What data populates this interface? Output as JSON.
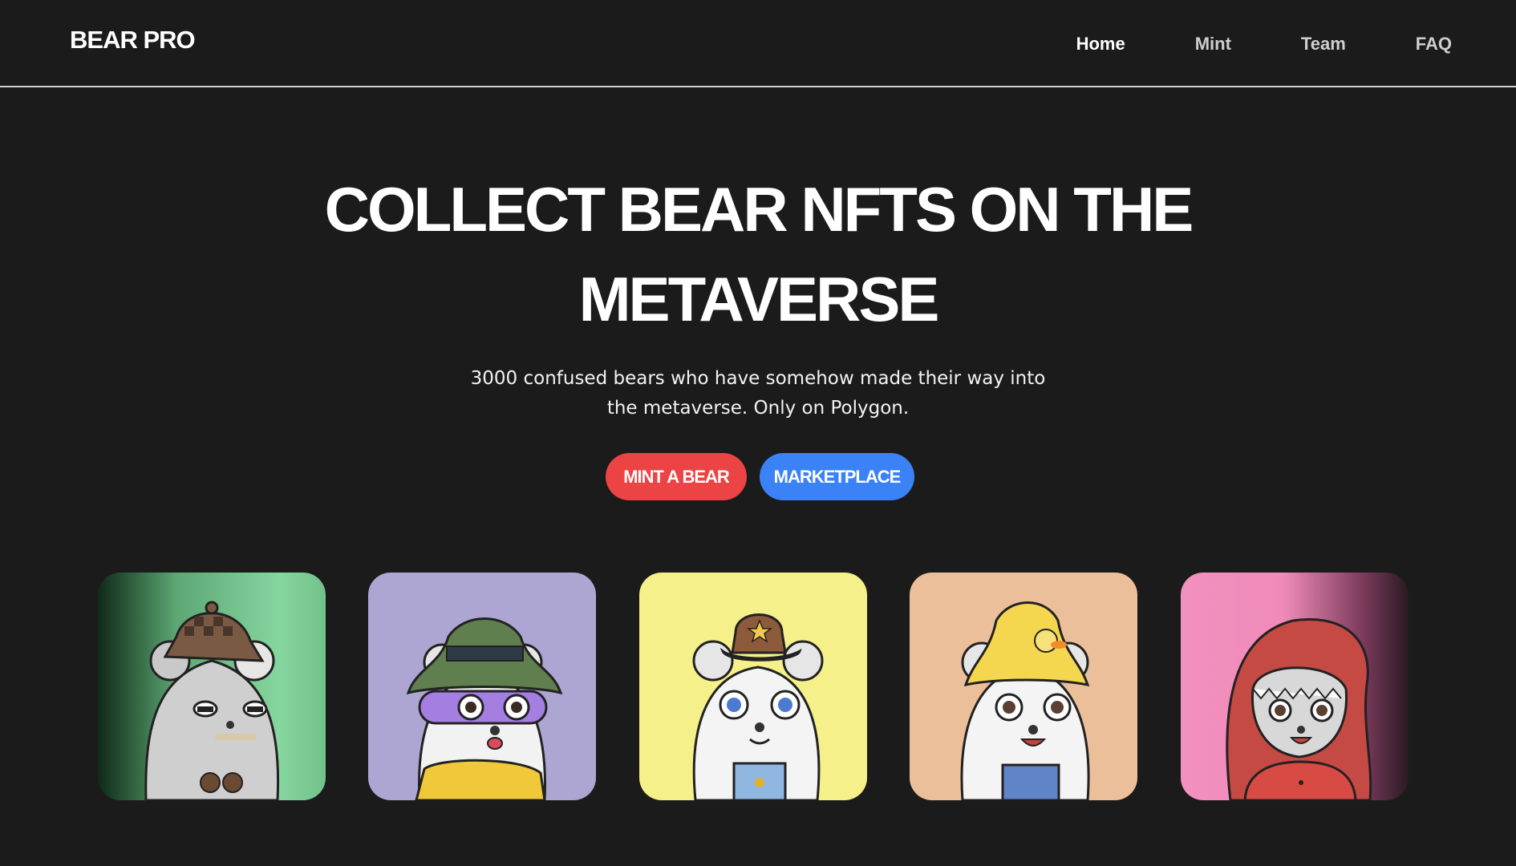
{
  "header": {
    "logo": "BEAR PRO",
    "nav": [
      {
        "label": "Home",
        "active": true
      },
      {
        "label": "Mint",
        "active": false
      },
      {
        "label": "Team",
        "active": false
      },
      {
        "label": "FAQ",
        "active": false
      }
    ]
  },
  "hero": {
    "title_line1": "COLLECT BEAR NFTS ON THE",
    "title_line2": "METAVERSE",
    "subtitle": "3000 confused bears who have somehow made their way into the metaverse. Only on Polygon.",
    "primary_button": "MINT A BEAR",
    "secondary_button": "MARKETPLACE"
  },
  "gallery": [
    {
      "name": "detective-bear",
      "bg": "#7fcf97",
      "hat": "checked-cap"
    },
    {
      "name": "bucket-hat-bear",
      "bg": "#ada6d2",
      "hat": "bucket-hat"
    },
    {
      "name": "sheriff-bear",
      "bg": "#f5f08a",
      "hat": "cowboy-hat"
    },
    {
      "name": "duck-hat-bear",
      "bg": "#ecbf9b",
      "hat": "duck-hat"
    },
    {
      "name": "dino-hood-bear",
      "bg": "#f290bf",
      "hat": "dino-hood"
    }
  ],
  "colors": {
    "background": "#1b1b1b",
    "mint_button": "#ec4444",
    "market_button": "#3b82f6"
  }
}
